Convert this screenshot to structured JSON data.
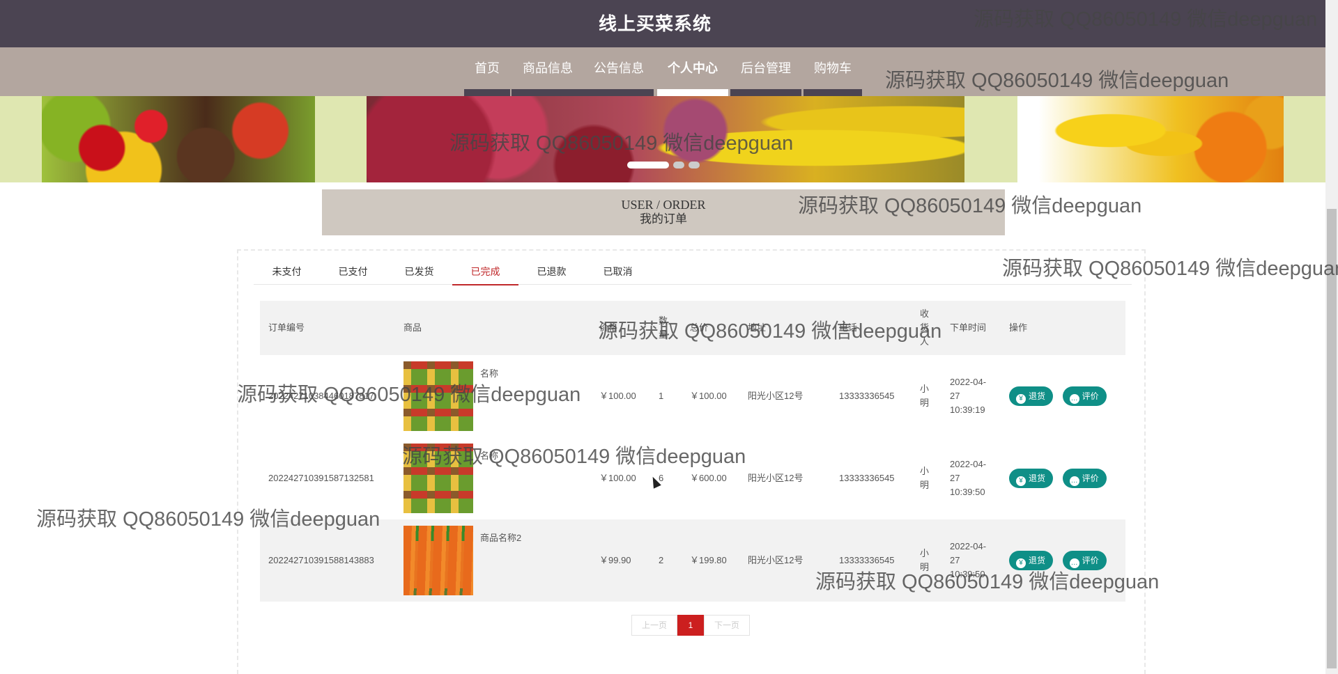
{
  "header": {
    "title": "线上买菜系统"
  },
  "nav": {
    "items": [
      {
        "label": "首页"
      },
      {
        "label": "商品信息"
      },
      {
        "label": "公告信息"
      },
      {
        "label": "个人中心"
      },
      {
        "label": "后台管理"
      },
      {
        "label": "购物车"
      }
    ],
    "active_index": 3
  },
  "banner": {
    "slide_count": 3,
    "active_slide": 0
  },
  "section": {
    "title_en": "USER / ORDER",
    "title_cn": "我的订单"
  },
  "tabs": {
    "items": [
      {
        "label": "未支付"
      },
      {
        "label": "已支付"
      },
      {
        "label": "已发货"
      },
      {
        "label": "已完成"
      },
      {
        "label": "已退款"
      },
      {
        "label": "已取消"
      }
    ],
    "active_index": 3
  },
  "table": {
    "headers": {
      "order_no": "订单编号",
      "product": "商品",
      "price": "价格",
      "qty": "数量",
      "total": "总价",
      "address": "地址",
      "phone": "电话",
      "receiver": "收货人",
      "time": "下单时间",
      "actions": "操作"
    },
    "rows": [
      {
        "order_no": "202242710384460187817",
        "product_name": "名称",
        "thumb": "veg",
        "price": "￥100.00",
        "qty": "1",
        "total": "￥100.00",
        "address": "阳光小区12号",
        "phone": "13333336545",
        "receiver": "小明",
        "time": "2022-04-27 10:39:19"
      },
      {
        "order_no": "202242710391587132581",
        "product_name": "名称",
        "thumb": "veg",
        "price": "￥100.00",
        "qty": "6",
        "total": "￥600.00",
        "address": "阳光小区12号",
        "phone": "13333336545",
        "receiver": "小明",
        "time": "2022-04-27 10:39:50"
      },
      {
        "order_no": "202242710391588143883",
        "product_name": "商品名称2",
        "thumb": "carrot",
        "price": "￥99.90",
        "qty": "2",
        "total": "￥199.80",
        "address": "阳光小区12号",
        "phone": "13333336545",
        "receiver": "小明",
        "time": "2022-04-27 10:39:50"
      }
    ],
    "refund_label": "退货",
    "review_label": "评价"
  },
  "pager": {
    "prev": "上一页",
    "current": "1",
    "next": "下一页"
  },
  "watermark": {
    "text": "源码获取 QQ86050149 微信deepguan"
  },
  "colors": {
    "header_bg": "#4b4452",
    "nav_bg": "#b3a69f",
    "accent_red": "#c0282a",
    "button_teal": "#0f8f87"
  }
}
